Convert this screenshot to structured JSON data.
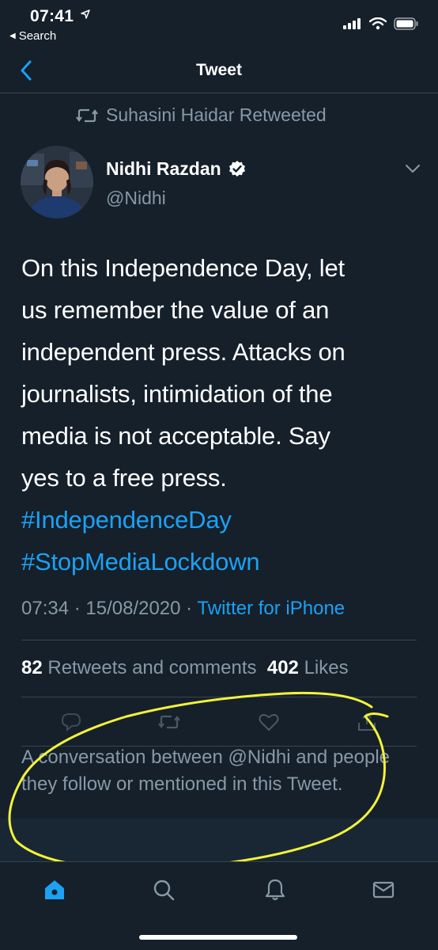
{
  "status_bar": {
    "time": "07:41",
    "back_app": "Search"
  },
  "nav": {
    "title": "Tweet"
  },
  "retweet": {
    "text": "Suhasini Haidar Retweeted"
  },
  "author": {
    "name": "Nidhi Razdan",
    "handle": "@Nidhi",
    "verified": true
  },
  "tweet": {
    "lines": [
      "On this Independence Day, let",
      "us remember the value of an",
      "independent press. Attacks on",
      "journalists, intimidation of the",
      "media is not acceptable. Say",
      "yes to a free press."
    ],
    "hashtags": [
      "#IndependenceDay",
      "#StopMediaLockdown"
    ]
  },
  "meta": {
    "timestamp": "07:34 · 15/08/2020 · ",
    "source": "Twitter for iPhone"
  },
  "stats": {
    "retweets_count": "82",
    "retweets_label": "Retweets and comments",
    "likes_count": "402",
    "likes_label": "Likes"
  },
  "conversation": {
    "notice": "A conversation between @Nidhi and people they follow or mentioned in this Tweet."
  },
  "colors": {
    "background": "#15202b",
    "accent": "#1da1f2",
    "secondary_text": "#8899a6",
    "annotation": "#f2f23a"
  },
  "icons": {
    "retweet": "retweet-icon",
    "verified": "verified-badge-icon",
    "reply": "reply-icon",
    "like": "heart-icon",
    "share": "share-icon",
    "home": "home-icon",
    "search": "search-icon",
    "notifications": "bell-icon",
    "messages": "mail-icon"
  }
}
